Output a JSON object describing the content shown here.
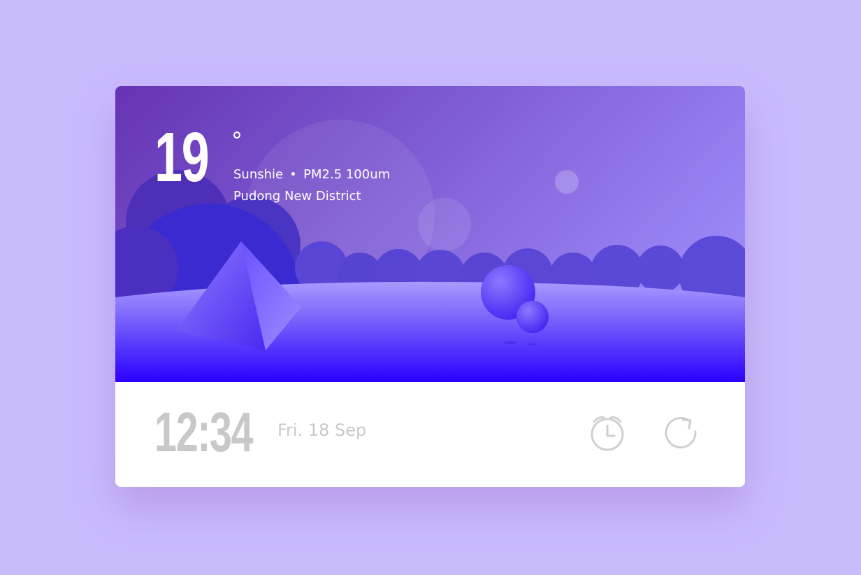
{
  "weather": {
    "temperature": "19",
    "degree_symbol": "°",
    "condition": "Sunshie",
    "air_quality": "PM2.5 100um",
    "location": "Pudong New District"
  },
  "time": {
    "clock": "12:34",
    "date": "Fri. 18 Sep"
  },
  "icons": {
    "alarm": "alarm-clock-icon",
    "refresh": "refresh-icon"
  },
  "colors": {
    "page_background": "#cabbfd",
    "sky_top": "#6b3bb8",
    "sky_bottom": "#9a82f5",
    "ground": "#2a00ff",
    "muted_text": "#c8c8c8"
  }
}
